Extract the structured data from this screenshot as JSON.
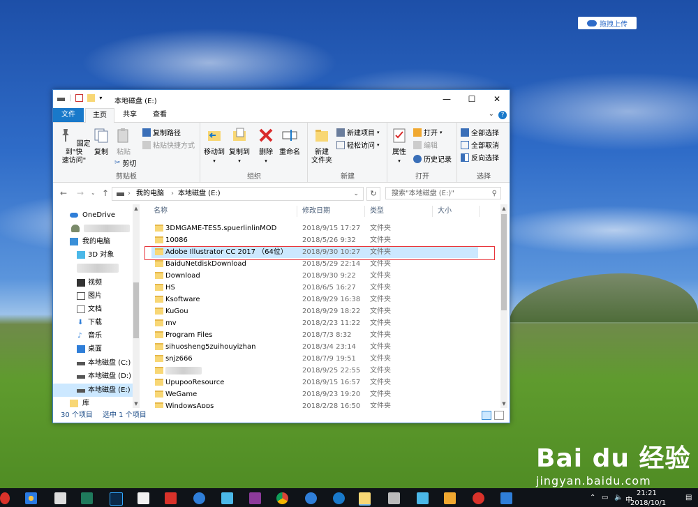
{
  "desktop": {
    "upload_label": "拖拽上传",
    "watermark_big": "Bai du 经验",
    "watermark_small": "jingyan.baidu.com"
  },
  "window": {
    "title": "本地磁盘 (E:)",
    "controls": {
      "minimize": "—",
      "maximize": "☐",
      "close": "✕"
    }
  },
  "tabs": [
    {
      "label": "文件"
    },
    {
      "label": "主页"
    },
    {
      "label": "共享"
    },
    {
      "label": "查看"
    }
  ],
  "ribbon": {
    "clipboard": {
      "pin_label": "固定到\"快\n速访问\"",
      "copy_label": "复制",
      "paste_label": "粘贴",
      "copy_path": "复制路径",
      "paste_shortcut": "粘贴快捷方式",
      "cut": "剪切",
      "group_label": "剪贴板"
    },
    "organize": {
      "move_to": "移动到",
      "copy_to": "复制到",
      "delete": "删除",
      "rename": "重命名",
      "group_label": "组织"
    },
    "new": {
      "new_folder": "新建\n文件夹",
      "new_item": "新建项目",
      "easy_access": "轻松访问",
      "group_label": "新建"
    },
    "open": {
      "properties": "属性",
      "open": "打开",
      "edit": "编辑",
      "history": "历史记录",
      "group_label": "打开"
    },
    "select": {
      "select_all": "全部选择",
      "select_none": "全部取消",
      "invert": "反向选择",
      "group_label": "选择"
    }
  },
  "address": {
    "path": [
      "我的电脑",
      "本地磁盘 (E:)"
    ],
    "search_placeholder": "搜索\"本地磁盘 (E:)\""
  },
  "nav": {
    "items": [
      {
        "label": "OneDrive"
      },
      {
        "label": ""
      },
      {
        "label": "我的电脑"
      },
      {
        "label": "3D 对象"
      },
      {
        "label": ""
      },
      {
        "label": "视频"
      },
      {
        "label": "图片"
      },
      {
        "label": "文档"
      },
      {
        "label": "下载"
      },
      {
        "label": "音乐"
      },
      {
        "label": "桌面"
      },
      {
        "label": "本地磁盘 (C:)"
      },
      {
        "label": "本地磁盘 (D:)"
      },
      {
        "label": "本地磁盘 (E:)"
      },
      {
        "label": "库"
      }
    ]
  },
  "columns": {
    "name": "名称",
    "date": "修改日期",
    "type": "类型",
    "size": "大小"
  },
  "files": [
    {
      "name": "3DMGAME-TES5.spuerlinlinMOD",
      "date": "2018/9/15 17:27",
      "type": "文件夹"
    },
    {
      "name": "10086",
      "date": "2018/5/26 9:32",
      "type": "文件夹"
    },
    {
      "name": "Adobe Illustrator CC 2017 （64位）",
      "date": "2018/9/30 10:27",
      "type": "文件夹"
    },
    {
      "name": "BaiduNetdiskDownload",
      "date": "2018/5/29 22:14",
      "type": "文件夹"
    },
    {
      "name": "Download",
      "date": "2018/9/30 9:22",
      "type": "文件夹"
    },
    {
      "name": "HS",
      "date": "2018/6/5 16:27",
      "type": "文件夹"
    },
    {
      "name": "Ksoftware",
      "date": "2018/9/29 16:38",
      "type": "文件夹"
    },
    {
      "name": "KuGou",
      "date": "2018/9/29 18:22",
      "type": "文件夹"
    },
    {
      "name": "mv",
      "date": "2018/2/23 11:22",
      "type": "文件夹"
    },
    {
      "name": "Program Files",
      "date": "2018/7/3 8:32",
      "type": "文件夹"
    },
    {
      "name": "sihuosheng5zuihouyizhan",
      "date": "2018/3/4 23:14",
      "type": "文件夹"
    },
    {
      "name": "snjz666",
      "date": "2018/7/9 19:51",
      "type": "文件夹"
    },
    {
      "name": "",
      "date": "2018/9/25 22:55",
      "type": "文件夹"
    },
    {
      "name": "UpupooResource",
      "date": "2018/9/15 16:57",
      "type": "文件夹"
    },
    {
      "name": "WeGame",
      "date": "2018/9/23 19:20",
      "type": "文件夹"
    },
    {
      "name": "WindowsApps",
      "date": "2018/2/28 16:50",
      "type": "文件夹"
    }
  ],
  "status": {
    "count": "30 个项目",
    "selected": "选中 1 个项目"
  },
  "taskbar": {
    "time": "21:21",
    "date": "2018/10/1"
  },
  "colors": {
    "accent": "#1979ca",
    "selection": "#cce8ff",
    "annotation": "#e8343a"
  }
}
